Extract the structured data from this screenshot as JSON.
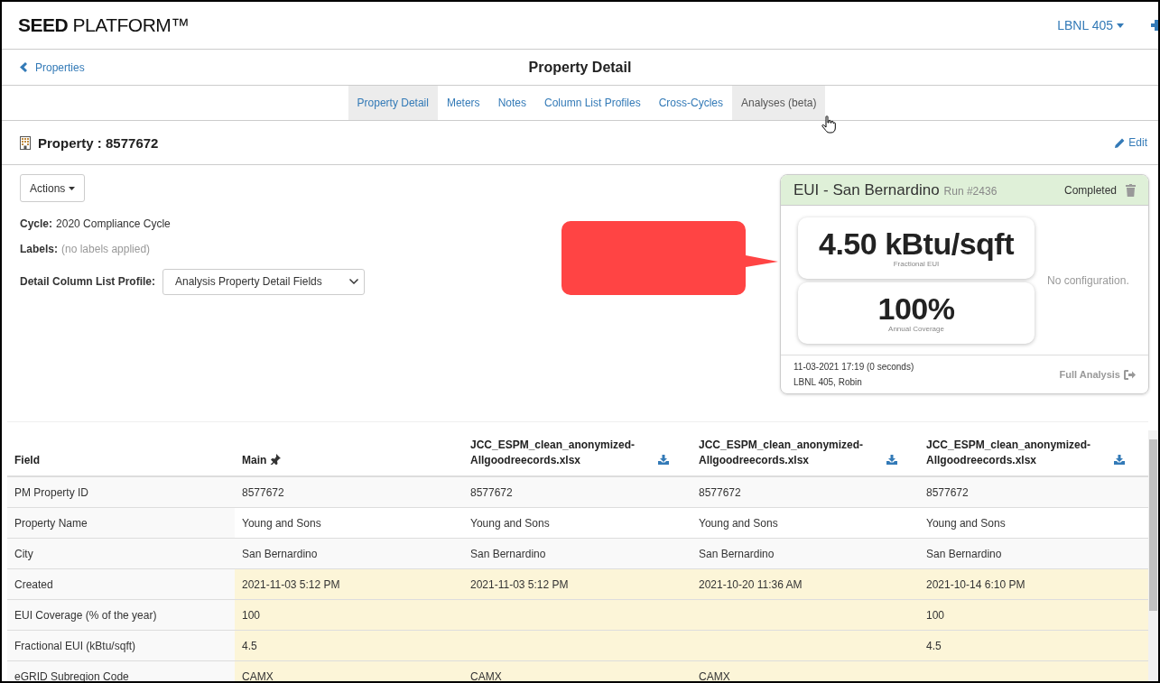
{
  "brand": {
    "bold": "SEED",
    "rest": "PLATFORM™"
  },
  "org_menu": {
    "label": "LBNL 405"
  },
  "breadcrumb": {
    "back_label": "Properties"
  },
  "page_title": "Property Detail",
  "tabs": [
    {
      "label": "Property Detail",
      "selected": true,
      "hovered": false
    },
    {
      "label": "Meters",
      "selected": false,
      "hovered": false
    },
    {
      "label": "Notes",
      "selected": false,
      "hovered": false
    },
    {
      "label": "Column List Profiles",
      "selected": false,
      "hovered": false
    },
    {
      "label": "Cross-Cycles",
      "selected": false,
      "hovered": false
    },
    {
      "label": "Analyses (beta)",
      "selected": false,
      "hovered": true
    }
  ],
  "property_heading": "Property : 8577672",
  "edit_link": "Edit",
  "actions_button": "Actions",
  "cycle": {
    "label": "Cycle:",
    "value": "2020 Compliance Cycle"
  },
  "labels": {
    "label": "Labels:",
    "value": "(no labels applied)"
  },
  "profile": {
    "label": "Detail Column List Profile:",
    "value": "Analysis Property Detail Fields"
  },
  "analysis": {
    "title": "EUI - San Bernardino",
    "run": "Run #2436",
    "status": "Completed",
    "metrics": [
      {
        "value": "4.50 kBtu/sqft",
        "caption": "Fractional EUI"
      },
      {
        "value": "100%",
        "caption": "Annual Coverage"
      }
    ],
    "configuration": "No configuration.",
    "timestamp": "11-03-2021 17:19 (0 seconds)",
    "author": "LBNL 405, Robin",
    "link": "Full Analysis"
  },
  "table": {
    "columns": [
      {
        "label": "Field",
        "kind": "field"
      },
      {
        "label": "Main",
        "kind": "pinned"
      },
      {
        "label": "JCC_ESPM_clean_anonymized-Allgoodreecords.xlsx",
        "kind": "file"
      },
      {
        "label": "JCC_ESPM_clean_anonymized-Allgoodreecords.xlsx",
        "kind": "file"
      },
      {
        "label": "JCC_ESPM_clean_anonymized-Allgoodreecords.xlsx",
        "kind": "file"
      }
    ],
    "rows": [
      {
        "highlighted": false,
        "cells": [
          "PM Property ID",
          "8577672",
          "8577672",
          "8577672",
          "8577672"
        ]
      },
      {
        "highlighted": false,
        "cells": [
          "Property Name",
          "Young and Sons",
          "Young and Sons",
          "Young and Sons",
          "Young and Sons"
        ]
      },
      {
        "highlighted": false,
        "cells": [
          "City",
          "San Bernardino",
          "San Bernardino",
          "San Bernardino",
          "San Bernardino"
        ]
      },
      {
        "highlighted": true,
        "cells": [
          "Created",
          "2021-11-03 5:12 PM",
          "2021-11-03 5:12 PM",
          "2021-10-20 11:36 AM",
          "2021-10-14 6:10 PM"
        ]
      },
      {
        "highlighted": true,
        "cells": [
          "EUI Coverage (% of the year)",
          "100",
          "",
          "",
          "100"
        ]
      },
      {
        "highlighted": true,
        "cells": [
          "Fractional EUI (kBtu/sqft)",
          "4.5",
          "",
          "",
          "4.5"
        ]
      },
      {
        "highlighted": true,
        "cells": [
          "eGRID Subregion Code",
          "CAMX",
          "CAMX",
          "CAMX",
          ""
        ]
      }
    ]
  }
}
